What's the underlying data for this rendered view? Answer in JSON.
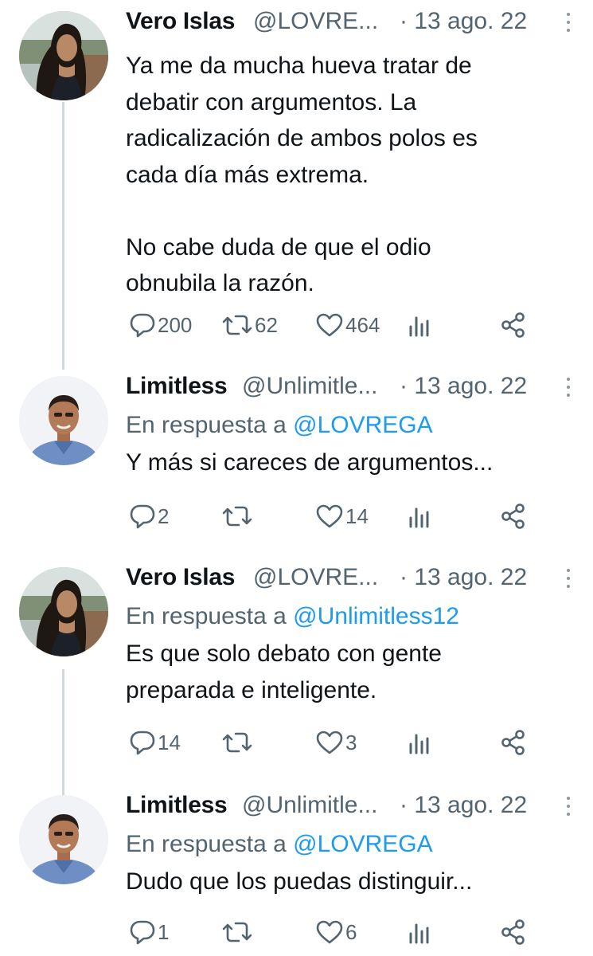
{
  "tweets": [
    {
      "author": "Vero Islas",
      "handle": "@LOVRE...",
      "date": "· 13 ago. 22",
      "reply_label": "",
      "reply_mention": "",
      "text": "Ya me da mucha hueva tratar de\ndebatir con argumentos. La\nradicalización de ambos polos es\ncada día más extrema.\n\nNo cabe duda de que el odio\nobnubila la razón.",
      "replies": "200",
      "retweets": "62",
      "likes": "464"
    },
    {
      "author": "Limitless",
      "handle": "@Unlimitle...",
      "date": "· 13 ago. 22",
      "reply_label": "En respuesta a ",
      "reply_mention": "@LOVREGA",
      "text": "Y más si careces de argumentos...",
      "replies": "2",
      "retweets": "",
      "likes": "14"
    },
    {
      "author": "Vero Islas",
      "handle": "@LOVRE...",
      "date": "· 13 ago. 22",
      "reply_label": "En respuesta a ",
      "reply_mention": "@Unlimitless12",
      "text": "Es que solo debato con gente\npreparada e inteligente.",
      "replies": "14",
      "retweets": "",
      "likes": "3"
    },
    {
      "author": "Limitless",
      "handle": "@Unlimitle...",
      "date": "· 13 ago. 22",
      "reply_label": "En respuesta a ",
      "reply_mention": "@LOVREGA",
      "text": "Dudo que los puedas distinguir...",
      "replies": "1",
      "retweets": "",
      "likes": "6"
    }
  ],
  "colors": {
    "text": "#0f1419",
    "secondary": "#536471",
    "link": "#1d9bf0",
    "thread_line": "#cfd9de"
  },
  "icons": [
    "reply-icon",
    "retweet-icon",
    "like-icon",
    "views-icon",
    "share-icon",
    "more-icon"
  ]
}
